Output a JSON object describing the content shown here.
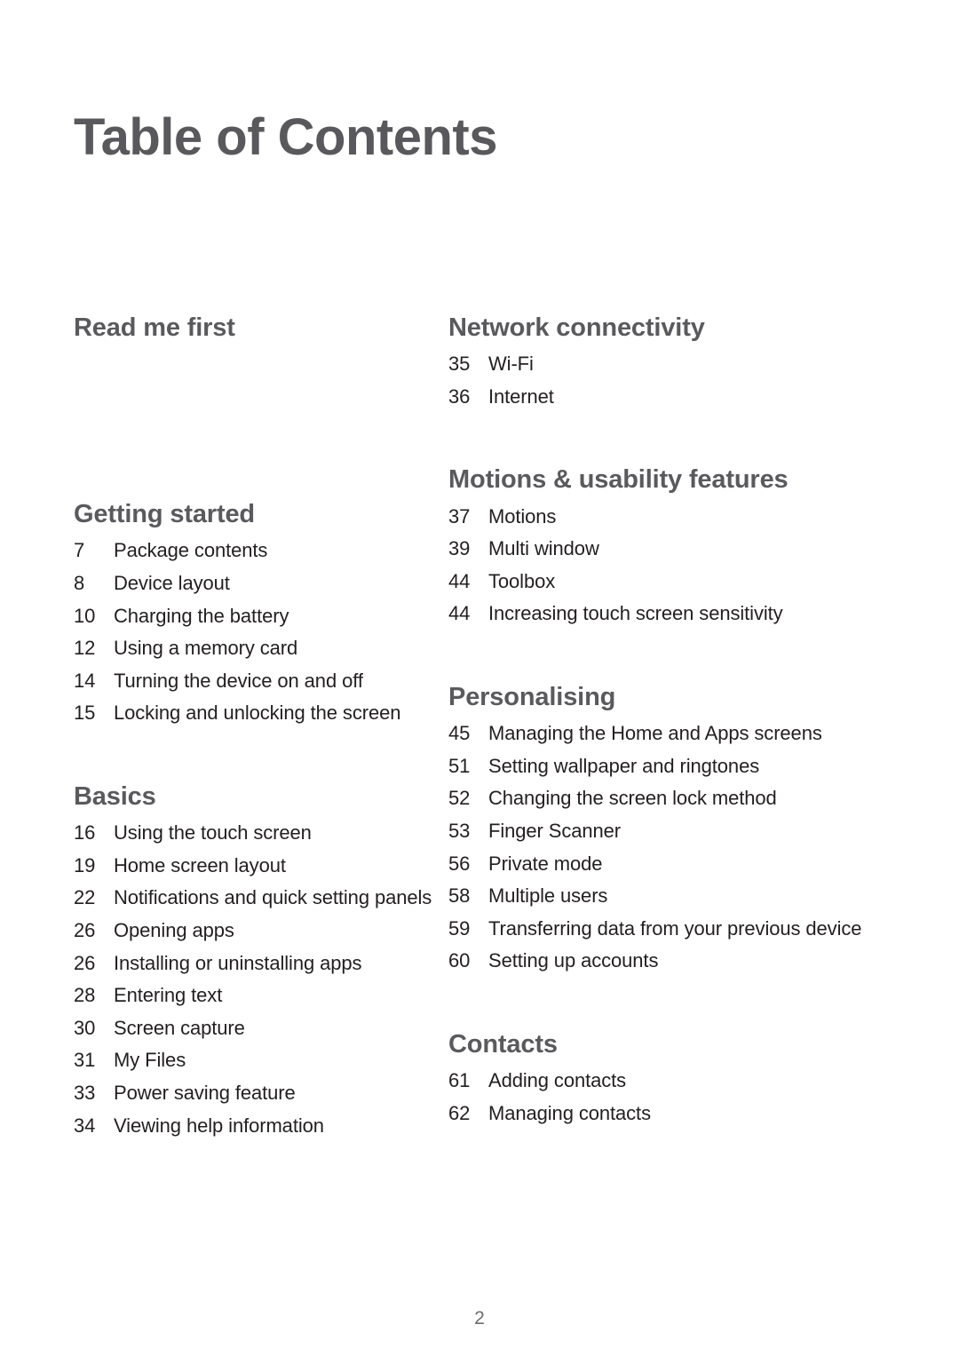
{
  "document": {
    "title": "Table of Contents",
    "page_number": "2",
    "colors": {
      "heading": "#5a5a5e",
      "entry_text": "#231f20",
      "page_number": "#6c6c70",
      "background": "#ffffff"
    }
  },
  "columns": {
    "left": [
      {
        "heading": "Read me first",
        "entries": []
      },
      {
        "heading": "Getting started",
        "entries": [
          {
            "page": "7",
            "title": "Package contents"
          },
          {
            "page": "8",
            "title": "Device layout"
          },
          {
            "page": "10",
            "title": "Charging the battery"
          },
          {
            "page": "12",
            "title": "Using a memory card"
          },
          {
            "page": "14",
            "title": "Turning the device on and off"
          },
          {
            "page": "15",
            "title": "Locking and unlocking the screen"
          }
        ]
      },
      {
        "heading": "Basics",
        "entries": [
          {
            "page": "16",
            "title": "Using the touch screen"
          },
          {
            "page": "19",
            "title": "Home screen layout"
          },
          {
            "page": "22",
            "title": "Notifications and quick setting panels"
          },
          {
            "page": "26",
            "title": "Opening apps"
          },
          {
            "page": "26",
            "title": "Installing or uninstalling apps"
          },
          {
            "page": "28",
            "title": "Entering text"
          },
          {
            "page": "30",
            "title": "Screen capture"
          },
          {
            "page": "31",
            "title": "My Files"
          },
          {
            "page": "33",
            "title": "Power saving feature"
          },
          {
            "page": "34",
            "title": "Viewing help information"
          }
        ]
      }
    ],
    "right": [
      {
        "heading": "Network connectivity",
        "entries": [
          {
            "page": "35",
            "title": "Wi-Fi"
          },
          {
            "page": "36",
            "title": "Internet"
          }
        ]
      },
      {
        "heading": "Motions & usability features",
        "entries": [
          {
            "page": "37",
            "title": "Motions"
          },
          {
            "page": "39",
            "title": "Multi window"
          },
          {
            "page": "44",
            "title": "Toolbox"
          },
          {
            "page": "44",
            "title": "Increasing touch screen sensitivity"
          }
        ]
      },
      {
        "heading": "Personalising",
        "entries": [
          {
            "page": "45",
            "title": "Managing the Home and Apps screens"
          },
          {
            "page": "51",
            "title": "Setting wallpaper and ringtones"
          },
          {
            "page": "52",
            "title": "Changing the screen lock method"
          },
          {
            "page": "53",
            "title": "Finger Scanner"
          },
          {
            "page": "56",
            "title": "Private mode"
          },
          {
            "page": "58",
            "title": "Multiple users"
          },
          {
            "page": "59",
            "title": "Transferring data from your previous device"
          },
          {
            "page": "60",
            "title": "Setting up accounts"
          }
        ]
      },
      {
        "heading": "Contacts",
        "entries": [
          {
            "page": "61",
            "title": "Adding contacts"
          },
          {
            "page": "62",
            "title": "Managing contacts"
          }
        ]
      }
    ]
  }
}
